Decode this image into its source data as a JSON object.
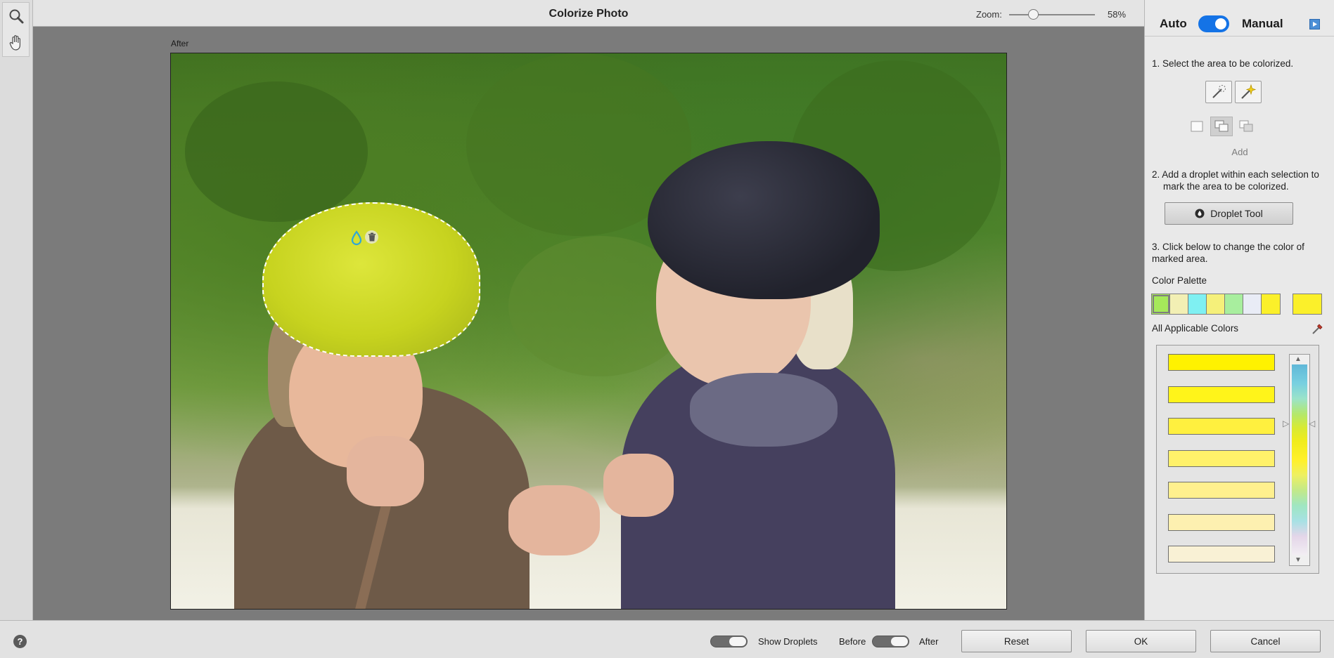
{
  "window": {
    "title": "Colorize Photo"
  },
  "zoom": {
    "label": "Zoom:",
    "value": "58%",
    "level": 0.58
  },
  "canvas": {
    "view_label": "After"
  },
  "tools": [
    {
      "name": "zoom-tool",
      "icon": "magnifier-icon"
    },
    {
      "name": "hand-tool",
      "icon": "hand-icon"
    }
  ],
  "mode": {
    "auto_label": "Auto",
    "manual_label": "Manual",
    "manual_enabled": true,
    "accent": "#1473e6"
  },
  "steps": {
    "step1": "1. Select the area to be colorized.",
    "step2a": "2. Add a droplet within each selection to",
    "step2b": "mark the area to be colorized.",
    "step3a": "3. Click below to change the color of",
    "step3b": "marked area."
  },
  "selection": {
    "mode_label": "Add",
    "modes": [
      "new-selection",
      "add-to-selection",
      "subtract-from-selection"
    ],
    "active_mode": "add-to-selection"
  },
  "droplet_tool": {
    "label": "Droplet Tool"
  },
  "palette": {
    "label": "Color Palette",
    "swatches": [
      "#a6e95a",
      "#f2efb4",
      "#7ff0f2",
      "#f5f07a",
      "#a8ee9e",
      "#e9ecf6",
      "#fbf02a"
    ],
    "current": "#fbf02a"
  },
  "applicable": {
    "label": "All Applicable Colors",
    "colors": [
      "#fff200",
      "#fff41a",
      "#fff03f",
      "#fff16a",
      "#fff08e",
      "#fdf0b0",
      "#f9f1d5"
    ]
  },
  "bottom": {
    "help": "?",
    "show_droplets_label": "Show Droplets",
    "before_label": "Before",
    "after_label": "After",
    "reset_label": "Reset",
    "ok_label": "OK",
    "cancel_label": "Cancel"
  }
}
